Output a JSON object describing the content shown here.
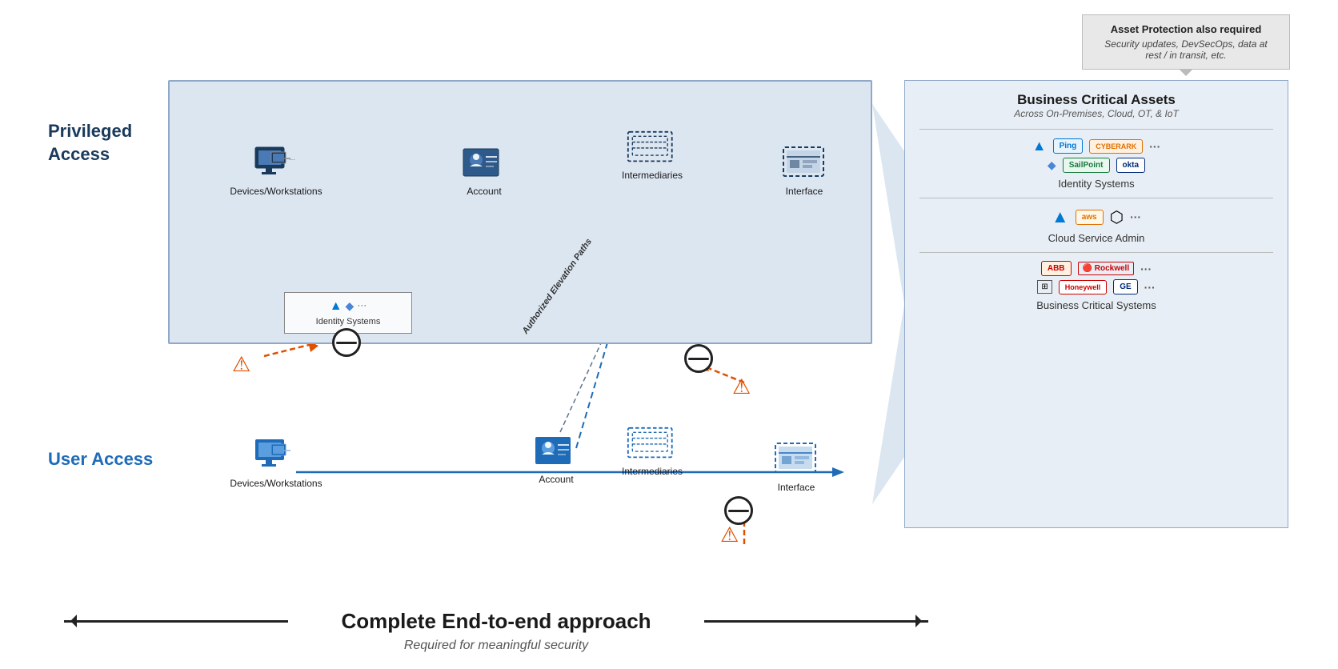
{
  "callout": {
    "title": "Asset Protection also required",
    "body": "Security updates, DevSecOps, data at rest / in transit, etc."
  },
  "privileged_access": {
    "label": "Privileged Access"
  },
  "user_access": {
    "label": "User Access"
  },
  "bca": {
    "title": "Business Critical Assets",
    "subtitle": "Across On-Premises, Cloud, OT, & IoT",
    "identity_label": "Identity Systems",
    "cloud_label": "Cloud Service Admin",
    "biz_label": "Business Critical Systems",
    "logos": {
      "identity": [
        "Ping",
        "CyberArk",
        "SailPoint",
        "okta",
        "..."
      ],
      "cloud": [
        "Azure",
        "aws",
        "GCP",
        "..."
      ],
      "biz": [
        "ABB",
        "Rockwell",
        "OT",
        "Honeywell",
        "GE",
        "..."
      ]
    }
  },
  "nodes": {
    "priv_devices": "Devices/Workstations",
    "priv_account": "Account",
    "priv_intermediaries": "Intermediaries",
    "priv_interface": "Interface",
    "user_devices": "Devices/Workstations",
    "user_account": "Account",
    "user_intermediaries": "Intermediaries",
    "user_interface": "Interface",
    "identity_systems": "Identity Systems"
  },
  "authorized_label": "Authorized Elevation Paths",
  "bottom": {
    "title": "Complete End-to-end approach",
    "subtitle": "Required for meaningful security"
  }
}
